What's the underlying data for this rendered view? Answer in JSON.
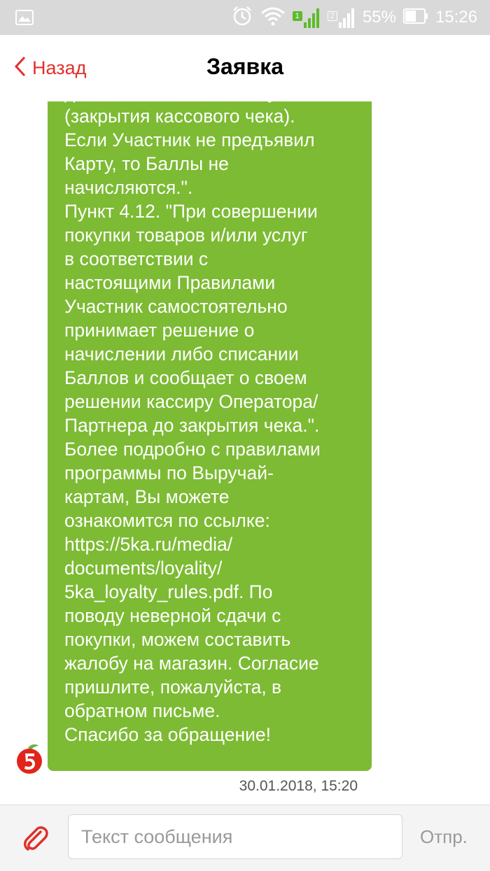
{
  "status_bar": {
    "sim1_label": "1",
    "sim2_label": "2",
    "battery": "55%",
    "time": "15:26",
    "icons": [
      "image-icon",
      "alarm-icon",
      "wifi-icon",
      "signal-icon",
      "battery-icon"
    ]
  },
  "header": {
    "back_label": "Назад",
    "title": "Заявка"
  },
  "message": {
    "text": "до момента оплаты покупки\n(закрытия кассового чека).\nЕсли Участник не предъявил\nКарту, то Баллы не\nначисляются.\".\nПункт 4.12. \"При совершении\nпокупки товаров и/или услуг\nв соответствии с\nнастоящими Правилами\nУчастник самостоятельно\nпринимает решение о\nначислении либо списании\nБаллов и сообщает о своем\nрешении кассиру Оператора/\nПартнера до закрытия чека.\".\nБолее подробно с правилами\nпрограммы по Выручай-\nкартам, Вы можете\nознакомится по ссылке:\nhttps://5ka.ru/media/\ndocuments/loyality/\n5ka_loyalty_rules.pdf. По\nповоду неверной сдачи с\nпокупки, можем составить\nжалобу на магазин. Согласие\nпришлите, пожалуйста, в\nобратном письме.\nСпасибо за обращение!",
    "timestamp": "30.01.2018, 15:20"
  },
  "composer": {
    "placeholder": "Текст сообщения",
    "send_label": "Отпр."
  },
  "colors": {
    "accent": "#e0302b",
    "bubble": "#7cbb33",
    "status_bar": "#d9d9d9"
  }
}
